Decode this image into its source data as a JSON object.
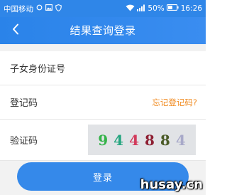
{
  "status_bar": {
    "carrier": "中国移动",
    "battery": "50%",
    "time": "16:26",
    "icons": [
      "circle-icon",
      "image-icon",
      "shield-icon",
      "wifi-icon",
      "signal-icon",
      "battery-icon"
    ]
  },
  "header": {
    "back_icon": "chevron-left-icon",
    "title": "结果查询登录",
    "color": "#2f86e8"
  },
  "form": {
    "id_label": "子女身份证号",
    "reg_code_label": "登记码",
    "forgot_link": "忘记登记码?",
    "verify_label": "验证码",
    "captcha": [
      {
        "char": "9",
        "color": "#34b349"
      },
      {
        "char": "4",
        "color": "#25a57f"
      },
      {
        "char": "4",
        "color": "#d23a5b"
      },
      {
        "char": "8",
        "color": "#8e2033"
      },
      {
        "char": "8",
        "color": "#4a5a26"
      },
      {
        "char": "4",
        "color": "#a8a9c9"
      }
    ]
  },
  "login_label": "登录",
  "watermark": "husay.cn",
  "colors": {
    "accent": "#2f86e8",
    "link": "#f08a1f"
  }
}
